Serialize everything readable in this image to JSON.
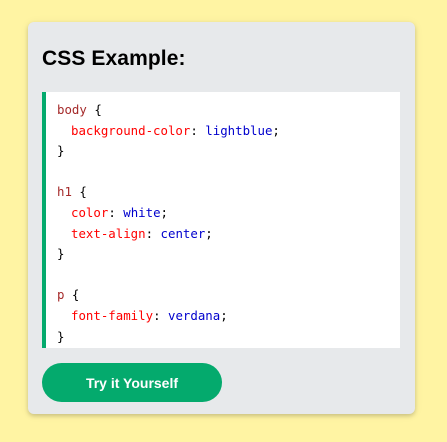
{
  "card": {
    "title": "CSS Example:"
  },
  "code": {
    "lines": [
      [
        {
          "t": "selector",
          "v": "body "
        },
        {
          "t": "punct",
          "v": "{"
        }
      ],
      [
        {
          "t": "prop",
          "v": "background-color"
        },
        {
          "t": "punct",
          "v": ": "
        },
        {
          "t": "val",
          "v": "lightblue"
        },
        {
          "t": "punct",
          "v": ";"
        }
      ],
      [
        {
          "t": "punct",
          "v": "}"
        }
      ],
      [],
      [
        {
          "t": "selector",
          "v": "h1 "
        },
        {
          "t": "punct",
          "v": "{"
        }
      ],
      [
        {
          "t": "prop",
          "v": "color"
        },
        {
          "t": "punct",
          "v": ": "
        },
        {
          "t": "val",
          "v": "white"
        },
        {
          "t": "punct",
          "v": ";"
        }
      ],
      [
        {
          "t": "prop",
          "v": "text-align"
        },
        {
          "t": "punct",
          "v": ": "
        },
        {
          "t": "val",
          "v": "center"
        },
        {
          "t": "punct",
          "v": ";"
        }
      ],
      [
        {
          "t": "punct",
          "v": "}"
        }
      ],
      [],
      [
        {
          "t": "selector",
          "v": "p "
        },
        {
          "t": "punct",
          "v": "{"
        }
      ],
      [
        {
          "t": "prop",
          "v": "font-family"
        },
        {
          "t": "punct",
          "v": ": "
        },
        {
          "t": "val",
          "v": "verdana"
        },
        {
          "t": "punct",
          "v": ";"
        }
      ],
      [
        {
          "t": "punct",
          "v": "}"
        }
      ]
    ],
    "indented_lines": [
      1,
      5,
      6,
      10
    ]
  },
  "button": {
    "label": "Try it Yourself"
  },
  "colors": {
    "page_background": "#fff4a3",
    "card_background": "#e7e9eb",
    "accent": "#04aa6d",
    "selector": "#a52a2a",
    "property": "#ff0000",
    "value": "#0000cd"
  }
}
